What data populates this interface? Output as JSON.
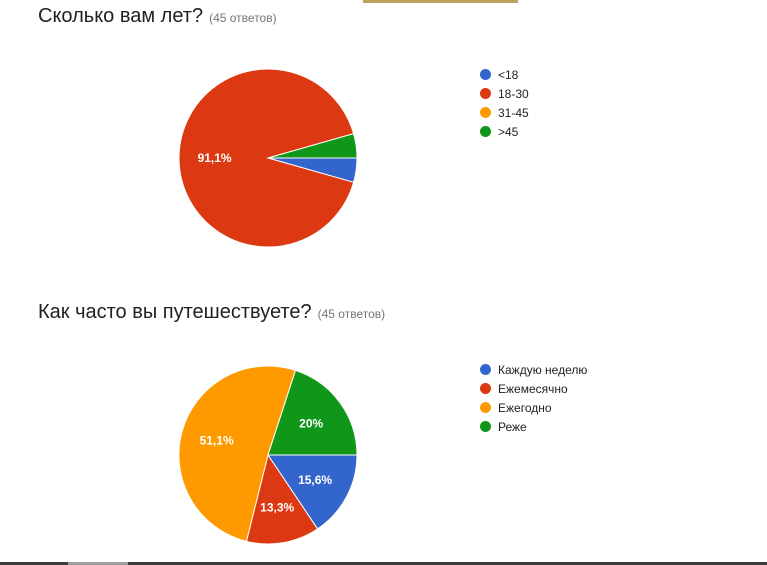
{
  "chart_data": [
    {
      "type": "pie",
      "title": "Сколько вам лет?",
      "subtitle": "(45 ответов)",
      "categories": [
        "<18",
        "18-30",
        "31-45",
        ">45"
      ],
      "values": [
        4.4,
        91.1,
        0,
        4.4
      ],
      "labels": [
        "",
        "91,1%",
        "",
        ""
      ],
      "colors": [
        "#3366cc",
        "#dc3912",
        "#ff9900",
        "#109618"
      ],
      "legend": "right"
    },
    {
      "type": "pie",
      "title": "Как часто вы путешествуете?",
      "subtitle": "(45 ответов)",
      "categories": [
        "Каждую неделю",
        "Ежемесячно",
        "Ежегодно",
        "Реже"
      ],
      "values": [
        15.6,
        13.3,
        51.1,
        20
      ],
      "labels": [
        "15,6%",
        "13,3%",
        "51,1%",
        "20%"
      ],
      "colors": [
        "#3366cc",
        "#dc3912",
        "#ff9900",
        "#109618"
      ],
      "legend": "right"
    }
  ],
  "colors": {
    "accent": "#c0a060"
  }
}
